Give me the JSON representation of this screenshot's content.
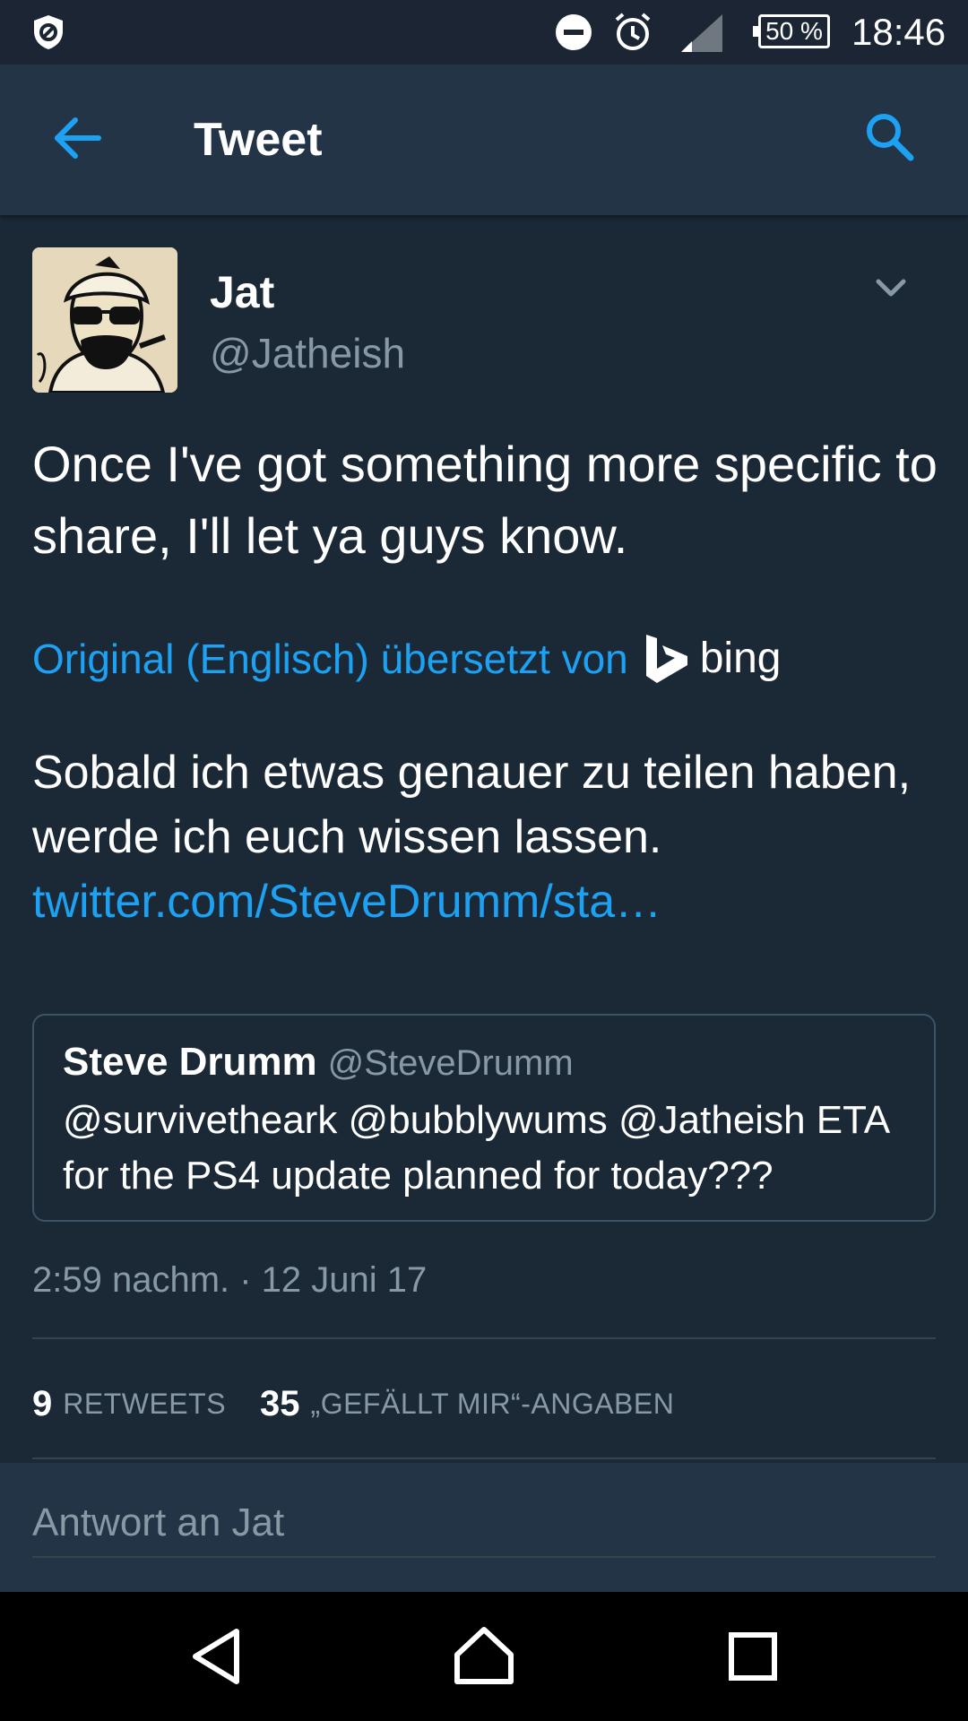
{
  "status_bar": {
    "time": "18:46",
    "battery": "50 %",
    "icons": [
      "shield-icon",
      "do-not-disturb-icon",
      "alarm-icon",
      "signal-icon",
      "battery-icon"
    ]
  },
  "app_bar": {
    "title": "Tweet",
    "back_icon": "arrow-left-icon",
    "search_icon": "search-icon"
  },
  "tweet": {
    "author_name": "Jat",
    "author_handle": "@Jatheish",
    "text": "Once I've got something more specific to share, I'll let ya guys know.",
    "translated_by_label": "Original (Englisch) übersetzt von",
    "translator_name": "bing",
    "translation_text": "Sobald ich etwas genauer zu teilen haben, werde ich euch wissen lassen.",
    "translation_link": "twitter.com/SteveDrumm/sta…",
    "timestamp": "2:59 nachm. · 12 Juni 17"
  },
  "quoted_tweet": {
    "name": "Steve Drumm",
    "handle": "@SteveDrumm",
    "text": "@survivetheark @bubblywums @Jatheish ETA for the PS4 update planned for today???"
  },
  "stats": {
    "retweets_count": "9",
    "retweets_label": "RETWEETS",
    "likes_count": "35",
    "likes_label": "„GEFÄLLT MIR“-ANGABEN"
  },
  "reply": {
    "placeholder": "Antwort an Jat"
  },
  "colors": {
    "background": "#1b2836",
    "app_bar": "#243447",
    "accent": "#1da1f2",
    "secondary_text": "#8899a6"
  }
}
